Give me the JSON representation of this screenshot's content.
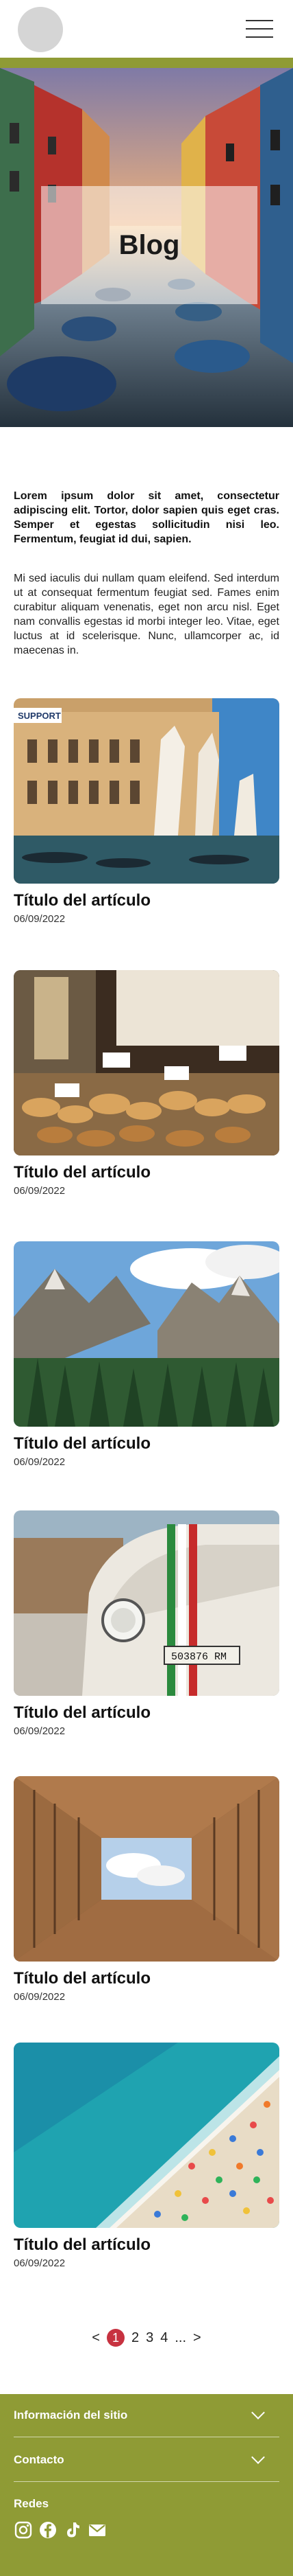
{
  "header": {
    "logo": "logo-placeholder",
    "menu_icon": "hamburger-icon"
  },
  "colors": {
    "accent": "#8f9b35",
    "active_page": "#c73240"
  },
  "hero": {
    "title": "Blog"
  },
  "intro": {
    "bold": "Lorem ipsum dolor sit amet, consectetur adipiscing elit. Tortor, dolor sapien quis eget cras. Semper et egestas sollicitudin nisi leo. Fermentum, feugiat id dui, sapien.",
    "regular": "Mi sed iaculis dui nullam quam eleifend. Sed interdum ut at consequat fermentum feugiat sed. Fames enim curabitur aliquam venenatis, eget non arcu nisl. Eget nam convallis egestas id morbi integer leo. Vitae, eget luctus at id scelerisque. Nunc, ullamcorper ac, id maecenas in."
  },
  "articles": [
    {
      "title": "Título del artículo",
      "date": "06/09/2022",
      "image": "venice-hands-sculpture",
      "sign": "SUPPORT"
    },
    {
      "title": "Título del artículo",
      "date": "06/09/2022",
      "image": "bakery-pastries"
    },
    {
      "title": "Título del artículo",
      "date": "06/09/2022",
      "image": "dolomites-mountains"
    },
    {
      "title": "Título del artículo",
      "date": "06/09/2022",
      "image": "vintage-fiat-500",
      "plate": "503876 RM"
    },
    {
      "title": "Título del artículo",
      "date": "06/09/2022",
      "image": "courtyard-looking-up"
    },
    {
      "title": "Título del artículo",
      "date": "06/09/2022",
      "image": "crowded-beach-aerial"
    }
  ],
  "pagination": {
    "prev": "<",
    "pages": [
      "1",
      "2",
      "3",
      "4"
    ],
    "ellipsis": "...",
    "next": ">",
    "current": "1"
  },
  "footer": {
    "site_info": "Información del sitio",
    "contact": "Contacto",
    "social_label": "Redes",
    "social": [
      "instagram-icon",
      "facebook-icon",
      "tiktok-icon",
      "mail-icon"
    ]
  }
}
